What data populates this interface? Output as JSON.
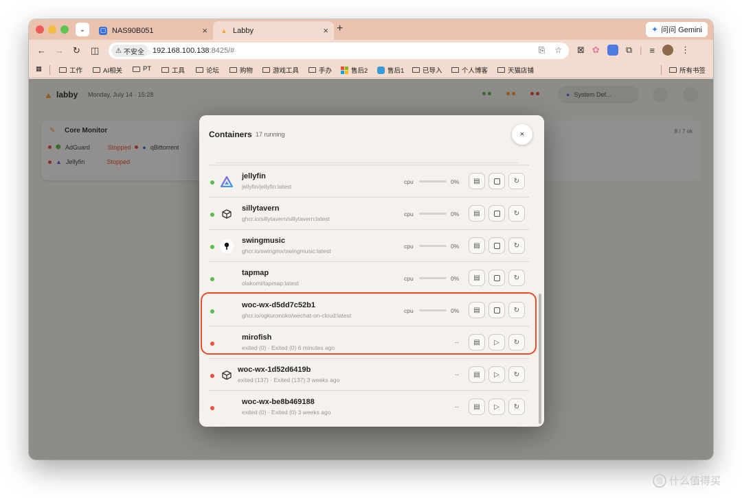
{
  "tabs": [
    {
      "title": "NAS90B051",
      "favicon": "nas-icon",
      "active": false
    },
    {
      "title": "Labby",
      "favicon": "labby-flame-icon",
      "active": true
    }
  ],
  "gemini_button": "问问 Gemini",
  "address": {
    "security_label": "不安全",
    "host": "192.168.100.138",
    "rest": ":8425/#"
  },
  "bookmarks": [
    {
      "label": "工作",
      "icon": "folder-icon"
    },
    {
      "label": "AI相关",
      "icon": "folder-icon"
    },
    {
      "label": "PT",
      "icon": "folder-icon"
    },
    {
      "label": "工具",
      "icon": "folder-icon"
    },
    {
      "label": "论坛",
      "icon": "folder-icon"
    },
    {
      "label": "购物",
      "icon": "folder-icon"
    },
    {
      "label": "游戏工具",
      "icon": "folder-icon"
    },
    {
      "label": "手办",
      "icon": "folder-icon"
    },
    {
      "label": "售后2",
      "icon": "windows-logo-icon"
    },
    {
      "label": "售后1",
      "icon": "app-icon"
    },
    {
      "label": "已导入",
      "icon": "folder-icon"
    },
    {
      "label": "个人博客",
      "icon": "folder-icon"
    },
    {
      "label": "天猫店铺",
      "icon": "folder-icon"
    }
  ],
  "all_bookmarks": "所有书签",
  "app": {
    "name": "labby",
    "date": "Monday, July 14 · 15:28",
    "system_select": "System Def...",
    "card_title": "Core Monitor",
    "card_rows": [
      {
        "name": "AdGuard",
        "status": "Stopped",
        "other": "qBittorrent"
      },
      {
        "name": "Jellyfin",
        "status": "Stopped"
      }
    ],
    "right_card_label": "8 / 7 ok"
  },
  "modal": {
    "title": "Containers",
    "subtitle": "17 running",
    "close_label": "×",
    "cpu_label": "cpu",
    "containers": [
      {
        "name": "jellyfin",
        "image": "jellyfin/jellyfin:latest",
        "status": "running",
        "cpu": "0%",
        "cpu_fraction": 0,
        "icon": "jellyfin-triangle-icon"
      },
      {
        "name": "sillytavern",
        "image": "ghcr.io/sillytavern/sillytavern:latest",
        "status": "running",
        "cpu": "0%",
        "cpu_fraction": 0,
        "icon": "cube-icon"
      },
      {
        "name": "swingmusic",
        "image": "ghcr.io/swingmx/swingmusic:latest",
        "status": "running",
        "cpu": "0%",
        "cpu_fraction": 0,
        "icon": "swingmusic-icon"
      },
      {
        "name": "tapmap",
        "image": "olakomi/tapmap:latest",
        "status": "running",
        "cpu": "0%",
        "cpu_fraction": 0,
        "icon": ""
      },
      {
        "name": "woc-wx-d5dd7c52b1",
        "image": "ghcr.io/ogkuronoko/wechat-on-cloud:latest",
        "status": "running",
        "cpu": "0%",
        "cpu_fraction": 0,
        "icon": ""
      },
      {
        "name": "mirofish",
        "image": "exited (0) · Exited (0) 6 minutes ago",
        "status": "stopped",
        "cpu": "--",
        "cpu_fraction": 0,
        "icon": ""
      },
      {
        "name": "woc-wx-1d52d6419b",
        "image": "exited (137) · Exited (137) 3 weeks ago",
        "status": "stopped",
        "cpu": "--",
        "cpu_fraction": 0,
        "icon": "cube-icon"
      },
      {
        "name": "woc-wx-be8b469188",
        "image": "exited (0) · Exited (0) 3 weeks ago",
        "status": "stopped",
        "cpu": "--",
        "cpu_fraction": 0,
        "icon": ""
      }
    ]
  },
  "watermark": "什么值得买",
  "colors": {
    "running": "#5dbb4d",
    "stopped": "#e5533a",
    "highlight": "#e84a2a",
    "tabstrip": "#e9c2b0"
  }
}
